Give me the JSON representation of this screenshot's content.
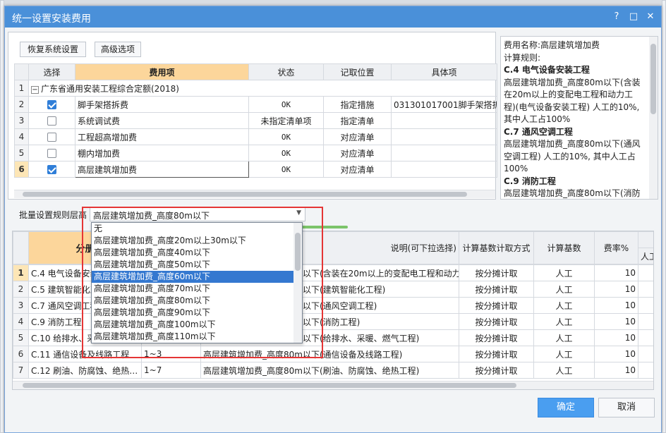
{
  "dialog": {
    "title": "统一设置安装费用",
    "help_icon": "?",
    "max_icon": "□",
    "close_icon": "✕"
  },
  "toolbar": {
    "restore_label": "恢复系统设置",
    "advanced_label": "高级选项"
  },
  "top_table": {
    "headers": [
      "选择",
      "费用项",
      "状态",
      "记取位置",
      "具体项"
    ],
    "group_label": "广东省通用安装工程综合定额(2018)",
    "rows": [
      {
        "n": "1"
      },
      {
        "n": "2",
        "checked": true,
        "name": "脚手架搭拆费",
        "status": "OK",
        "position": "指定措施",
        "detail": "031301017001脚手架搭拆费"
      },
      {
        "n": "3",
        "checked": false,
        "name": "系统调试费",
        "status": "未指定清单项",
        "position": "指定清单",
        "detail": ""
      },
      {
        "n": "4",
        "checked": false,
        "name": "工程超高增加费",
        "status": "OK",
        "position": "对应清单",
        "detail": ""
      },
      {
        "n": "5",
        "checked": false,
        "name": "棚内增加费",
        "status": "OK",
        "position": "对应清单",
        "detail": ""
      },
      {
        "n": "6",
        "checked": true,
        "name": "高层建筑增加费",
        "status": "OK",
        "position": "对应清单",
        "detail": ""
      }
    ]
  },
  "info_panel": {
    "lines": [
      {
        "t": "费用名称:高层建筑增加费",
        "b": false
      },
      {
        "t": "计算规则:",
        "b": false
      },
      {
        "t": "C.4 电气设备安装工程",
        "b": true
      },
      {
        "t": "高层建筑增加费_高度80m以下(含装",
        "b": false
      },
      {
        "t": "在20m以上的变配电工程和动力工",
        "b": false
      },
      {
        "t": "程)(电气设备安装工程) 人工的10%,",
        "b": false
      },
      {
        "t": "其中人工占100%",
        "b": false
      },
      {
        "t": "C.7 通风空调工程",
        "b": true
      },
      {
        "t": "高层建筑增加费_高度80m以下(通风",
        "b": false
      },
      {
        "t": "空调工程) 人工的10%, 其中人工占",
        "b": false
      },
      {
        "t": "100%",
        "b": false
      },
      {
        "t": "C.9 消防工程",
        "b": true
      },
      {
        "t": "高层建筑增加费_高度80m以下(消防",
        "b": false
      }
    ]
  },
  "batch": {
    "label": "批量设置规则层高",
    "selected": "高层建筑增加费_高度80m以下",
    "options": [
      "无",
      "高层建筑增加费_高度20m以上30m以下",
      "高层建筑增加费_高度40m以下",
      "高层建筑增加费_高度50m以下",
      "高层建筑增加费_高度60m以下",
      "高层建筑增加费_高度70m以下",
      "高层建筑增加费_高度80m以下",
      "高层建筑增加费_高度90m以下",
      "高层建筑增加费_高度100m以下",
      "高层建筑增加费_高度110m以下"
    ],
    "highlighted_index": 4
  },
  "bottom_table": {
    "headers": [
      "分册",
      "",
      "说明(可下拉选择)",
      "计算基数计取方式",
      "计算基数",
      "费率%",
      "人工"
    ],
    "rows": [
      {
        "n": "1",
        "book": "C.4 电气设备安装工程",
        "floor": "",
        "desc": "高层建筑增加费_高度80m以下(含装在20m以上的变配电工程和动力…",
        "mode": "按分摊计取",
        "base": "人工",
        "rate": "10"
      },
      {
        "n": "2",
        "book": "C.5 建筑智能化工程",
        "floor": "",
        "desc": "高层建筑增加费_高度80m以下(建筑智能化工程)",
        "mode": "按分摊计取",
        "base": "人工",
        "rate": "10"
      },
      {
        "n": "3",
        "book": "C.7 通风空调工程",
        "floor": "",
        "desc": "高层建筑增加费_高度80m以下(通风空调工程)",
        "mode": "按分摊计取",
        "base": "人工",
        "rate": "10"
      },
      {
        "n": "4",
        "book": "C.9 消防工程",
        "floor": "",
        "desc": "高层建筑增加费_高度80m以下(消防工程)",
        "mode": "按分摊计取",
        "base": "人工",
        "rate": "10"
      },
      {
        "n": "5",
        "book": "C.10 给排水、采暖、燃气工程",
        "floor": "",
        "desc": "高层建筑增加费_高度80m以下(给排水、采暖、燃气工程)",
        "mode": "按分摊计取",
        "base": "人工",
        "rate": "10"
      },
      {
        "n": "6",
        "book": "C.11 通信设备及线路工程",
        "floor": "1~3",
        "desc": "高层建筑增加费_高度80m以下(通信设备及线路工程)",
        "mode": "按分摊计取",
        "base": "人工",
        "rate": "10"
      },
      {
        "n": "7",
        "book": "C.12 刷油、防腐蚀、绝热…",
        "floor": "1~7",
        "desc": "高层建筑增加费_高度80m以下(刷油、防腐蚀、绝热工程)",
        "mode": "按分摊计取",
        "base": "人工",
        "rate": "10"
      }
    ]
  },
  "footer": {
    "ok_label": "确定",
    "cancel_label": "取消"
  },
  "colors": {
    "title_bar": "#4a90d9",
    "header_highlight": "#fcd69b",
    "selection": "#3478d0",
    "annotation": "#e53535",
    "ok_button": "#4a9ef0"
  }
}
